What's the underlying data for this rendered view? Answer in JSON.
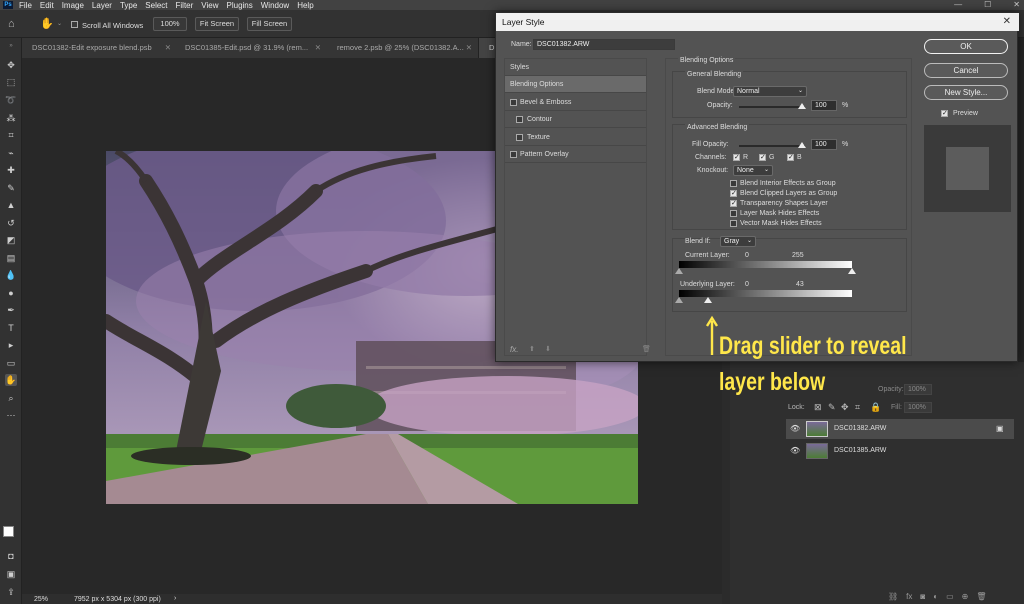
{
  "menubar": {
    "app_logo": "Ps",
    "items": [
      "File",
      "Edit",
      "Image",
      "Layer",
      "Type",
      "Select",
      "Filter",
      "View",
      "Plugins",
      "Window",
      "Help"
    ],
    "window_controls": [
      "—",
      "☐",
      "✕"
    ]
  },
  "options": {
    "scroll_all_label": "Scroll All Windows",
    "zoom_btn": "100%",
    "fit_btn": "Fit Screen",
    "fill_btn": "Fill Screen"
  },
  "tabs": [
    {
      "title": "DSC01382-Edit exposure blend.psb"
    },
    {
      "title": "DSC01385-Edit.psd @ 31.9% (rem..."
    },
    {
      "title": "remove 2.psb @ 25% (DSC01382.A..."
    },
    {
      "title": "D"
    }
  ],
  "status": {
    "zoom": "25%",
    "doc_info": "7952 px x 5304 px (300 ppi)"
  },
  "layers_panel": {
    "opacity_label": "Opacity:",
    "opacity_value": "100%",
    "lock_label": "Lock:",
    "fill_label": "Fill:",
    "fill_value": "100%",
    "layers": [
      {
        "name": "DSC01382.ARW",
        "selected": true
      },
      {
        "name": "DSC01385.ARW",
        "selected": false
      }
    ]
  },
  "dialog": {
    "title": "Layer Style",
    "name_label": "Name:",
    "name_value": "DSC01382.ARW",
    "styles_header": "Styles",
    "styles": [
      {
        "label": "Blending Options",
        "active": true,
        "checkbox": false
      },
      {
        "label": "Bevel & Emboss",
        "checkbox": true
      },
      {
        "label": "Contour",
        "checkbox": true,
        "sub": true
      },
      {
        "label": "Texture",
        "checkbox": true,
        "sub": true
      },
      {
        "label": "Pattern Overlay",
        "checkbox": true
      }
    ],
    "fx_label": "fx.",
    "blending_options_title": "Blending Options",
    "general_blending_title": "General Blending",
    "blend_mode_label": "Blend Mode:",
    "blend_mode_value": "Normal",
    "opacity_label": "Opacity:",
    "opacity_value": "100",
    "percent": "%",
    "advanced_blending_title": "Advanced Blending",
    "fill_opacity_label": "Fill Opacity:",
    "fill_opacity_value": "100",
    "channels_label": "Channels:",
    "channel_r": "R",
    "channel_g": "G",
    "channel_b": "B",
    "knockout_label": "Knockout:",
    "knockout_value": "None",
    "options": [
      {
        "label": "Blend Interior Effects as Group",
        "checked": false
      },
      {
        "label": "Blend Clipped Layers as Group",
        "checked": true
      },
      {
        "label": "Transparency Shapes Layer",
        "checked": true
      },
      {
        "label": "Layer Mask Hides Effects",
        "checked": false
      },
      {
        "label": "Vector Mask Hides Effects",
        "checked": false
      }
    ],
    "blend_if_label": "Blend If:",
    "blend_if_value": "Gray",
    "current_layer_label": "Current Layer:",
    "current_low": "0",
    "current_high": "255",
    "underlying_layer_label": "Underlying Layer:",
    "underlying_low": "0",
    "underlying_high": "43",
    "ok_label": "OK",
    "cancel_label": "Cancel",
    "new_style_label": "New Style...",
    "preview_label": "Preview",
    "preview_checked": true
  },
  "annotation": {
    "line1": "Drag slider to reveal",
    "line2": "layer below",
    "color": "#ffe74a"
  }
}
